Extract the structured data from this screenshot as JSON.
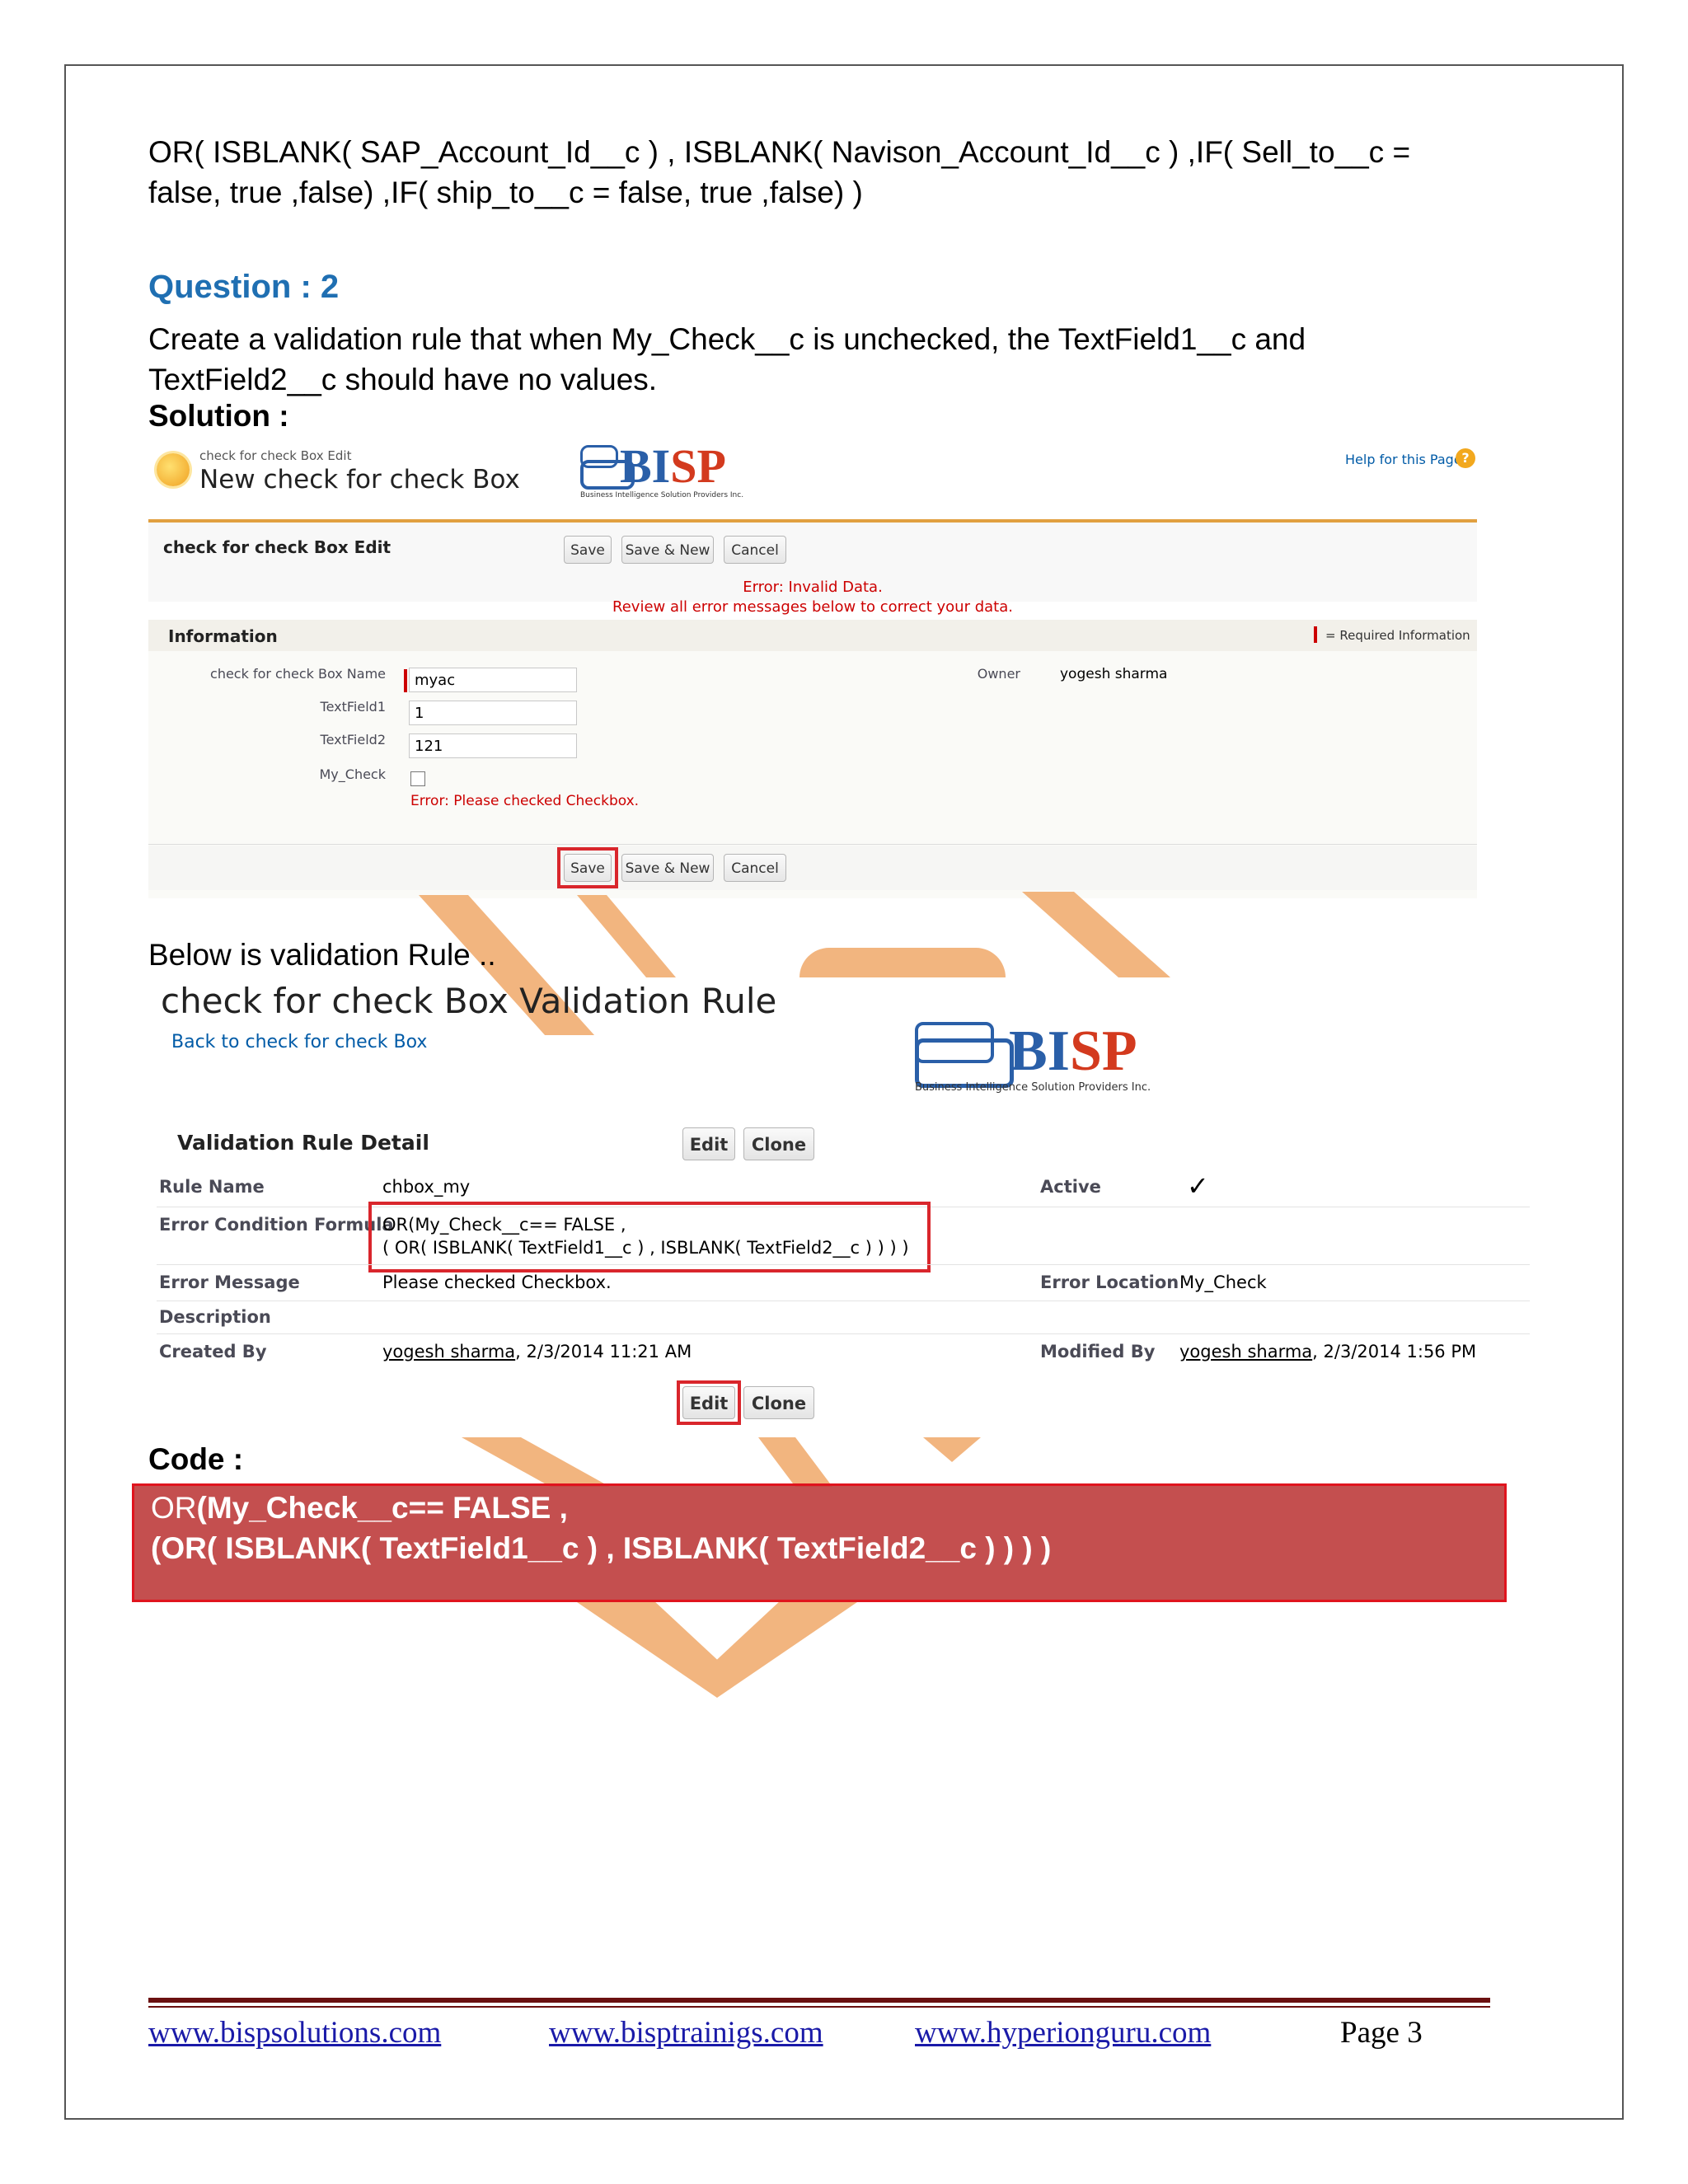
{
  "intro_formula": {
    "line1": "OR( ISBLANK( SAP_Account_Id__c ) , ISBLANK( Navison_Account_Id__c ) ,IF( Sell_to__c  =",
    "line2": "false,  true  ,false) ,IF(  ship_to__c   = false,  true  ,false) )"
  },
  "question": {
    "title": "Question : 2",
    "text_line1": "Create a validation rule that when My_Check__c is unchecked, the TextField1__c and",
    "text_line2": "TextField2__c should have no values.",
    "solution_label": "Solution :"
  },
  "edit_screen": {
    "breadcrumb": "check for check Box Edit",
    "title": "New check for check Box",
    "help_link": "Help for this Page",
    "section_title": "check for check Box Edit",
    "buttons": {
      "save": "Save",
      "save_new": "Save & New",
      "cancel": "Cancel"
    },
    "error_title": "Error: Invalid Data.",
    "error_text": "Review all error messages below to correct your data.",
    "info_header": "Information",
    "required_info": "= Required Information",
    "fields": {
      "name_label": "check for check Box Name",
      "name_value": "myac",
      "tf1_label": "TextField1",
      "tf1_value": "1",
      "tf2_label": "TextField2",
      "tf2_value": "121",
      "check_label": "My_Check",
      "check_error": "Error: Please checked Checkbox.",
      "owner_label": "Owner",
      "owner_value": "yogesh sharma"
    }
  },
  "bisp_logo": {
    "name": "BISP",
    "tagline": "Business Intelligence Solution Providers Inc."
  },
  "below_text": "Below is validation Rule ..",
  "detail_screen": {
    "title": "check for check Box Validation Rule",
    "back_link": "Back to check for check Box",
    "section_title": "Validation Rule Detail",
    "buttons": {
      "edit": "Edit",
      "clone": "Clone"
    },
    "rows": {
      "rule_name_label": "Rule Name",
      "rule_name_value": "chbox_my",
      "active_label": "Active",
      "active_mark": "✓",
      "formula_label": "Error Condition Formula",
      "formula_line1": "OR(My_Check__c== FALSE ,",
      "formula_line2": "( OR( ISBLANK( TextField1__c ) , ISBLANK( TextField2__c ) ) ) )",
      "message_label": "Error Message",
      "message_value": "Please checked Checkbox.",
      "location_label": "Error Location",
      "location_value": "My_Check",
      "description_label": "Description",
      "created_label": "Created By",
      "created_user": "yogesh sharma",
      "created_date": ", 2/3/2014 11:21 AM",
      "modified_label": "Modified By",
      "modified_user": "yogesh sharma",
      "modified_date": ", 2/3/2014 1:56 PM"
    }
  },
  "code": {
    "label": "Code :",
    "line1_prefix": "OR",
    "line1_rest": "(My_Check__c== FALSE ,",
    "line2": "(OR( ISBLANK( TextField1__c ) , ISBLANK( TextField2__c ) ) ) )"
  },
  "footer": {
    "link1": "www.bispsolutions.com",
    "link2": "www.bisptrainigs.com",
    "link3": "www.hyperionguru.com",
    "page_label": "Page ",
    "page_number": "3"
  },
  "colors": {
    "heading_blue": "#1f6fb2",
    "error_red": "#cc0000",
    "highlight_red": "#d9262c",
    "watermark_orange": "#f0a868",
    "footer_rule": "#6b1010"
  }
}
